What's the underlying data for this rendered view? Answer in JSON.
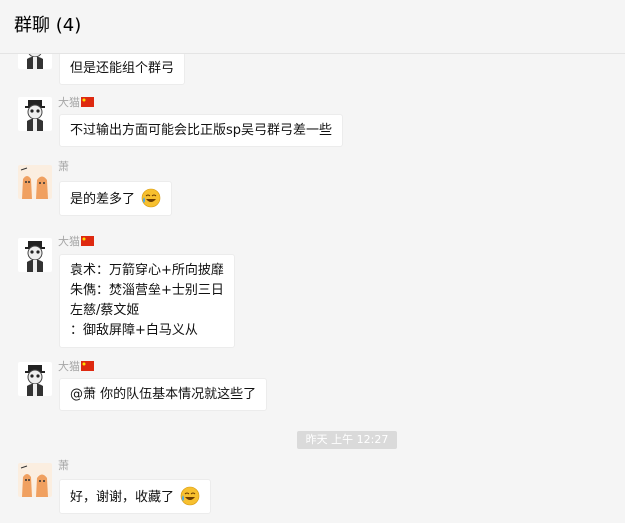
{
  "header": {
    "title": "群聊 (4)"
  },
  "senders": {
    "dazhu": "大猫",
    "xiao": "萧"
  },
  "messages": [
    {
      "text": "但是还能组个群弓"
    },
    {
      "text": "不过输出方面可能会比正版sp吴弓群弓差一些"
    },
    {
      "text": "是的差多了"
    },
    {
      "lines": [
        "袁术：万箭穿心+所向披靡",
        "朱儁：焚淄营垒+士别三日",
        "左慈/蔡文姬",
        "：御敌屏障+白马义从"
      ]
    },
    {
      "text": "@萧 你的队伍基本情况就这些了"
    },
    {
      "text": "好，谢谢，收藏了"
    }
  ],
  "timestamp": "昨天 上午 12:27",
  "icons": {
    "avatar_bw": "panda-gentleman-avatar",
    "avatar_cat": "cat-avatar",
    "flag": "china-flag-icon",
    "emoji": "laughing-tears-emoji"
  },
  "colors": {
    "background": "#f5f5f5",
    "bubble": "#ffffff",
    "sender_name": "#a6a6a6",
    "timestamp_bg": "#dadada"
  }
}
